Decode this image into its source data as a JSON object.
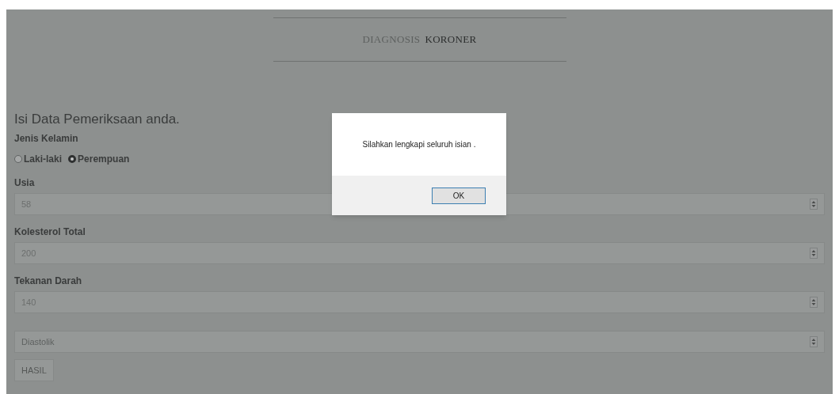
{
  "header": {
    "title_light": "DIAGNOSIS",
    "title_bold": "KORONER"
  },
  "form": {
    "heading": "Isi Data Pemeriksaan anda.",
    "gender": {
      "label": "Jenis Kelamin",
      "options": [
        {
          "label": "Laki-laki",
          "selected": false
        },
        {
          "label": "Perempuan",
          "selected": true
        }
      ]
    },
    "fields": [
      {
        "label": "Usia",
        "value": "58"
      },
      {
        "label": "Kolesterol Total",
        "value": "200"
      },
      {
        "label": "Tekanan Darah",
        "value": "140"
      },
      {
        "placeholder": "Diastolik"
      }
    ],
    "submit": "HASIL"
  },
  "dialog": {
    "message": "Silahkan lengkapi seluruh isian .",
    "button": "OK"
  }
}
